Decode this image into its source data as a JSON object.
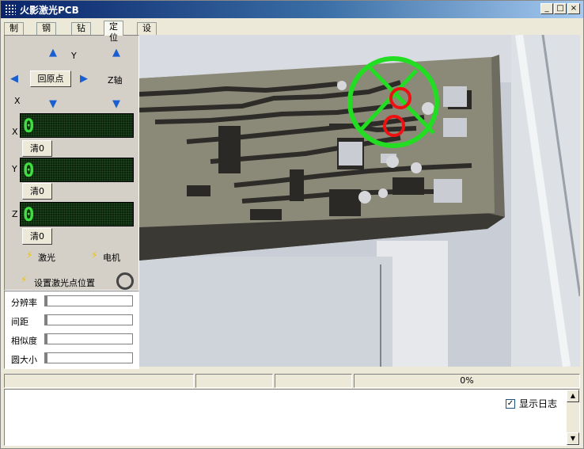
{
  "window": {
    "title": "火影激光PCB",
    "minimize": "_",
    "maximize": "□",
    "close": "×"
  },
  "tabs": [
    {
      "label": "制作"
    },
    {
      "label": "钢网"
    },
    {
      "label": "钻孔"
    },
    {
      "label": "定位",
      "active": true
    },
    {
      "label": "设置"
    }
  ],
  "jog": {
    "y_label": "Y",
    "z_label": "Z轴",
    "x_label": "X",
    "home_label": "回原点"
  },
  "axes": [
    {
      "name": "X",
      "value": "0",
      "clear_label": "清0"
    },
    {
      "name": "Y",
      "value": "0",
      "clear_label": "清0"
    },
    {
      "name": "Z",
      "value": "0",
      "clear_label": "清0"
    }
  ],
  "indicators": {
    "laser_label": "激光",
    "motor_label": "电机",
    "set_laser_point_label": "设置激光点位置"
  },
  "params": [
    {
      "label": "分辨率"
    },
    {
      "label": "间距"
    },
    {
      "label": "相似度"
    },
    {
      "label": "圆大小"
    }
  ],
  "status": {
    "progress": "0%"
  },
  "log": {
    "show_log_label": "显示日志",
    "show_log_checked": true
  },
  "colors": {
    "lcd_text": "#3fe03f",
    "crosshair": "#22dd22",
    "target_circle": "#ee1111",
    "arrow": "#1a5fd0"
  },
  "icons": [
    "app-icon",
    "up-arrow-icon",
    "down-arrow-icon",
    "left-arrow-icon",
    "right-arrow-icon",
    "lightning-icon",
    "laser-ring-icon",
    "checkbox-icon"
  ]
}
